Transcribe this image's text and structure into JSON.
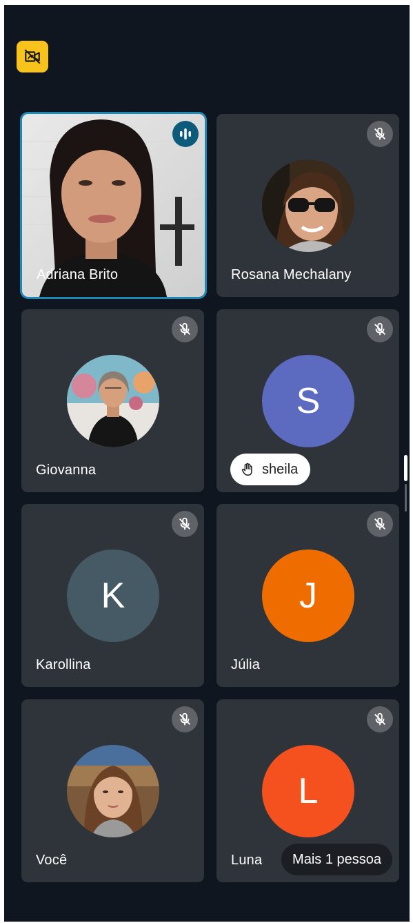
{
  "toolbar": {
    "camera_off_icon": "video-off-icon",
    "camera_button_color": "#f8c31c"
  },
  "participants": [
    {
      "name": "Adriana Brito",
      "state": "speaking",
      "type": "video"
    },
    {
      "name": "Rosana Mechalany",
      "state": "muted",
      "type": "photo"
    },
    {
      "name": "Giovanna",
      "state": "muted",
      "type": "photo"
    },
    {
      "name": "sheila",
      "initial": "S",
      "state": "muted",
      "type": "initial",
      "avatar_color": "#5c6bc0",
      "hand_raised": true
    },
    {
      "name": "Karollina",
      "initial": "K",
      "state": "muted",
      "type": "initial",
      "avatar_color": "#455a64"
    },
    {
      "name": "Júlia",
      "initial": "J",
      "state": "muted",
      "type": "initial",
      "avatar_color": "#ef6c00"
    },
    {
      "name": "Você",
      "state": "muted",
      "type": "photo"
    },
    {
      "name": "Luna",
      "initial": "L",
      "state": "muted",
      "type": "initial",
      "avatar_color": "#f4511e"
    }
  ],
  "more_people_label": "Mais 1 pessoa",
  "colors": {
    "background": "#0f1620",
    "tile": "#2f343a",
    "active_outline": "#1e88b4",
    "mute_badge": "#5f6368"
  }
}
